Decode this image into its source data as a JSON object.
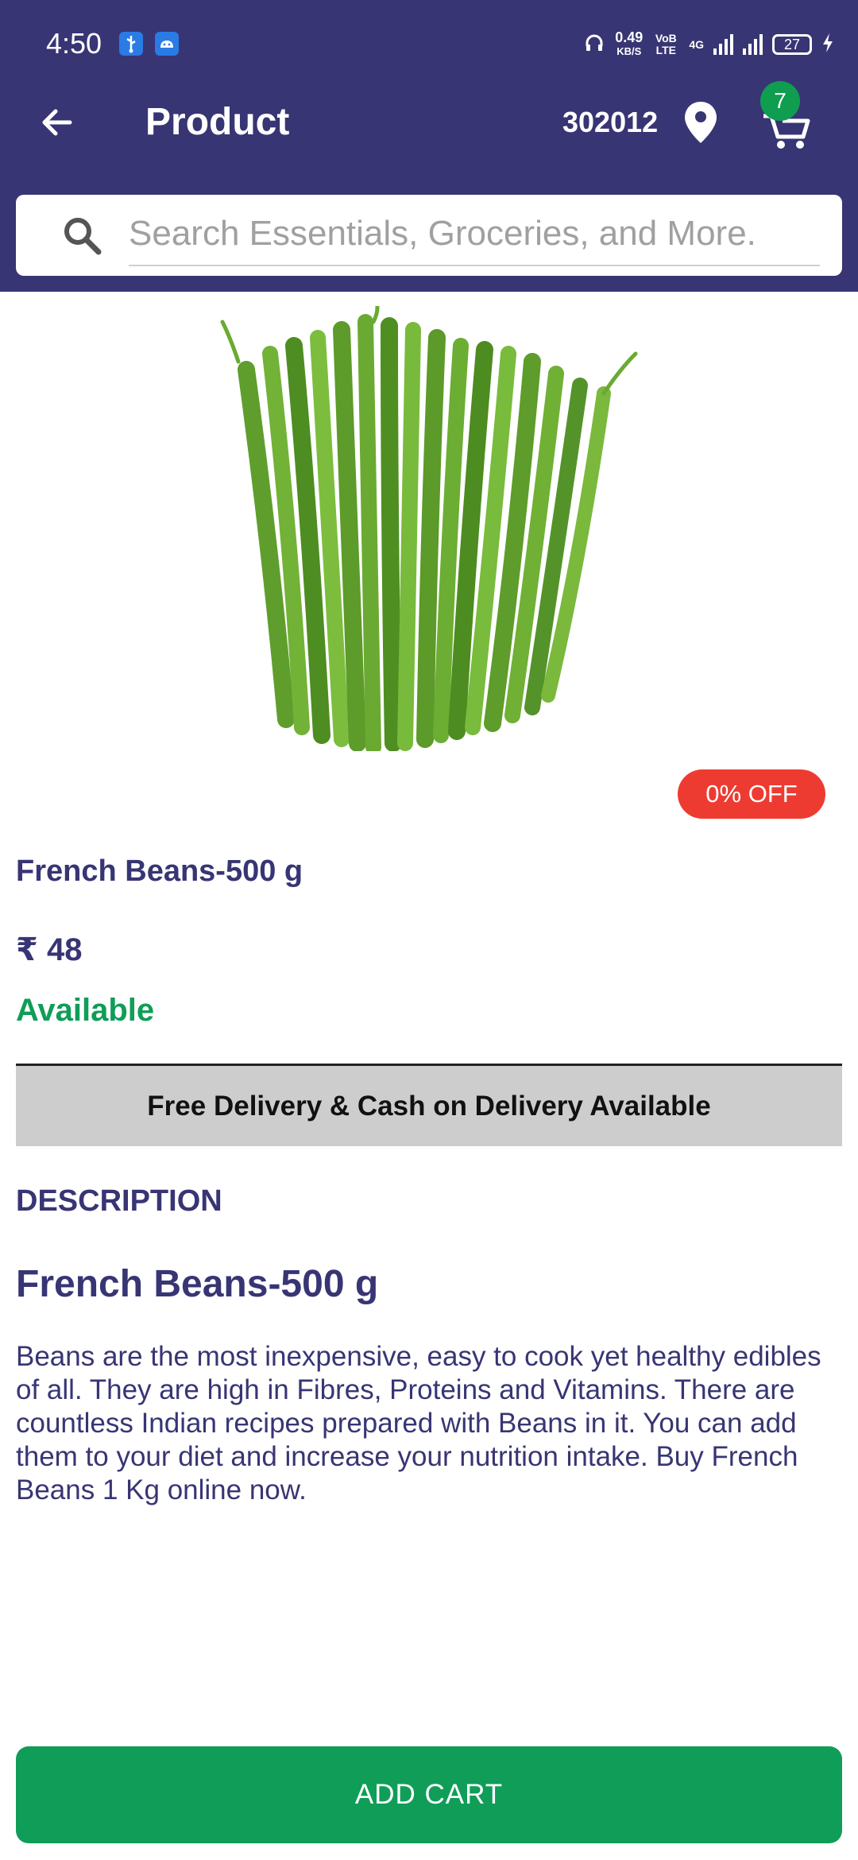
{
  "status_bar": {
    "time": "4:50",
    "speed_value": "0.49",
    "speed_unit": "KB/S",
    "volte": "VoB LTE",
    "network": "4G",
    "battery": "27"
  },
  "header": {
    "title": "Product",
    "pincode": "302012",
    "cart_count": "7",
    "icons": [
      "back-arrow-icon",
      "location-pin-icon",
      "cart-icon"
    ]
  },
  "search": {
    "placeholder": "Search Essentials, Groceries, and More.",
    "value": ""
  },
  "product": {
    "discount": "0% OFF",
    "name": "French Beans-500 g",
    "price": "₹ 48",
    "availability": "Available"
  },
  "delivery_banner": "Free Delivery & Cash on Delivery Available",
  "description": {
    "heading": "DESCRIPTION",
    "title": "French Beans-500 g",
    "body": "Beans are the most inexpensive, easy to cook yet healthy edibles of all. They are high in Fibres, Proteins and Vitamins. There are countless Indian recipes prepared with Beans in it. You can add them to your diet and increase your nutrition intake. Buy French Beans 1 Kg online now."
  },
  "actions": {
    "add_cart": "ADD CART"
  },
  "colors": {
    "header_bg": "#383574",
    "text_primary": "#383574",
    "available_green": "#0f9d58",
    "discount_red": "#ee3b32",
    "banner_gray": "#cdcdcd",
    "button_green": "#0f9d58"
  }
}
